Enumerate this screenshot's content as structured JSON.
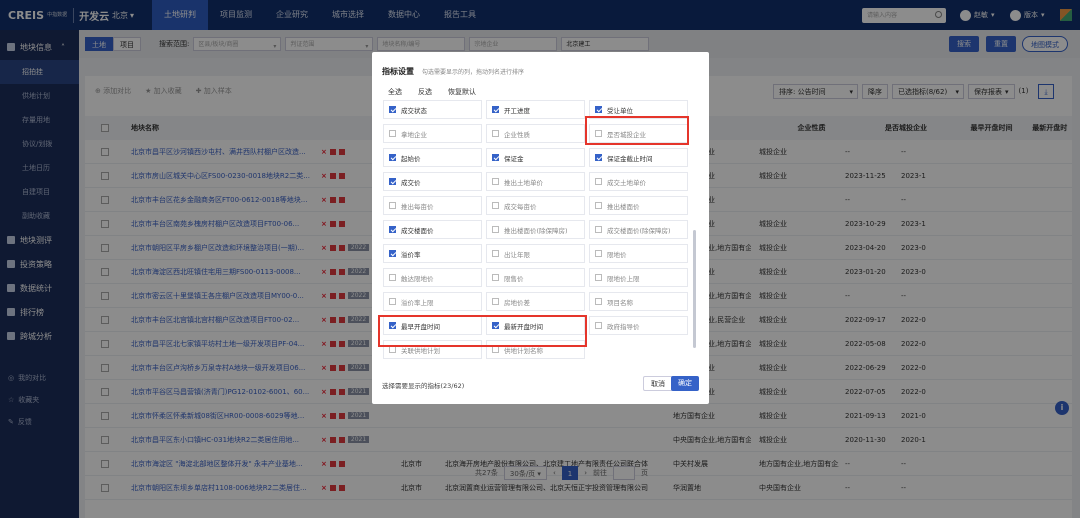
{
  "topnav": {
    "logo": "CREIS",
    "logo_sub": "中指数据",
    "app": "开发云",
    "city": "北京",
    "items": [
      "土地研判",
      "项目监测",
      "企业研究",
      "城市选择",
      "数据中心",
      "报告工具"
    ],
    "active": 0,
    "search_placeholder": "请输入内容",
    "user": "赵敏",
    "version": "版本"
  },
  "sidebar": {
    "main": "地块信息",
    "subs": [
      "招拍挂",
      "供地计划",
      "存量用地",
      "协议/划拨",
      "土地日历",
      "自建项目",
      "副助收藏"
    ],
    "active_sub": 0,
    "sections": [
      "地块测评",
      "投资策略",
      "数据统计",
      "排行榜",
      "跨城分析"
    ],
    "footer": [
      "我的对比",
      "收藏夹",
      "反馈"
    ]
  },
  "filterbar": {
    "toggle": [
      "土地",
      "项目"
    ],
    "label": "搜索范围:",
    "inputs": [
      "区县/板块/商圈",
      "判证范围",
      "地块名称/编号",
      "宗地企业"
    ],
    "input4": "北京建工",
    "search": "搜索",
    "reset": "重置",
    "map_mode": "地图模式"
  },
  "toolbar": {
    "items": [
      "添加对比",
      "加入收藏",
      "加入样本"
    ],
    "sort": "排序: 公告时间",
    "order": "降序",
    "selected": "已选指标(8/62)",
    "save": "保存报表",
    "count": "(1)"
  },
  "table": {
    "headers": [
      "地块名称",
      "企业性质",
      "是否城投企业",
      "最早开盘时间",
      "最新开盘时"
    ],
    "rows": [
      {
        "name": "北京市昌平区沙河镇西沙屯村、满井西队村棚户区改造...",
        "year": "",
        "d1": "",
        "d2": "",
        "c4": "地方国有企业",
        "c5": "城投企业",
        "c6": "--",
        "c7": "--"
      },
      {
        "name": "北京市房山区城关中心区FS00-0230-0018地块R2二类...",
        "year": "",
        "d1": "",
        "d2": "",
        "c4": "地方国有企业",
        "c5": "城投企业",
        "c6": "2023-11-25",
        "c7": "2023-1"
      },
      {
        "name": "北京市丰台区花乡金融商务区FT00-0612-0018等地块...",
        "year": "",
        "d1": "",
        "d2": "",
        "c4": "地方国有企业",
        "c5": "",
        "c6": "--",
        "c7": "--"
      },
      {
        "name": "北京市丰台区南苑乡槐房村棚户区改造项目FT00-06...",
        "year": "",
        "d1": "",
        "d2": "",
        "c4": "地方国有企业",
        "c5": "城投企业",
        "c6": "2023-10-29",
        "c7": "2023-1"
      },
      {
        "name": "北京市朝阳区平房乡棚户区改造和环境整治项目(一期)...",
        "year": "2022",
        "d1": "",
        "d2": "",
        "c4": "中央国有企业,地方国有企业",
        "c5": "城投企业",
        "c6": "2023-04-20",
        "c7": "2023-0"
      },
      {
        "name": "北京市海淀区西北旺镇住宅用三期FS00-0113-0008...",
        "year": "2022",
        "d1": "",
        "d2": "",
        "c4": "地方国有企业",
        "c5": "城投企业",
        "c6": "2023-01-20",
        "c7": "2023-0"
      },
      {
        "name": "北京市密云区十里堡镇王各庄棚户区改造项目MY00-0...",
        "year": "2022",
        "d1": "",
        "d2": "",
        "c4": "地方国有企业,地方国有企业",
        "c5": "城投企业",
        "c6": "--",
        "c7": "--"
      },
      {
        "name": "北京市丰台区北宫镇北宫村棚户区改造项目FT00-02...",
        "year": "2022",
        "d1": "",
        "d2": "",
        "c4": "地方国有企业,民营企业",
        "c5": "城投企业",
        "c6": "2022-09-17",
        "c7": "2022-0"
      },
      {
        "name": "北京市昌平区北七家镇平坊村土地一级开发项目PF-04...",
        "year": "2021",
        "d1": "",
        "d2": "",
        "c4": "地方国有企业,地方国有企业",
        "c5": "城投企业",
        "c6": "2022-05-08",
        "c7": "2022-0"
      },
      {
        "name": "北京市丰台区卢沟桥乡万泉寺村A地块一级开发项目06...",
        "year": "2021",
        "d1": "",
        "d2": "",
        "c4": "地方国有企业",
        "c5": "城投企业",
        "c6": "2022-06-29",
        "c7": "2022-0"
      },
      {
        "name": "北京市平谷区马昌营镇(济青门)PG12-0102-6001、60...",
        "year": "2021",
        "d1": "",
        "d2": "",
        "c4": "地方国有企业",
        "c5": "城投企业",
        "c6": "2022-07-05",
        "c7": "2022-0"
      },
      {
        "name": "北京市怀柔区怀柔新城08街区HR00-0008-6029等地...",
        "year": "2021",
        "d1": "",
        "d2": "",
        "c4": "地方国有企业",
        "c5": "城投企业",
        "c6": "2021-09-13",
        "c7": "2021-0"
      },
      {
        "name": "北京市昌平区东小口镇HC-031地块R2二类居住用地...",
        "year": "2021",
        "d1": "",
        "d2": "",
        "c4": "中央国有企业,地方国有企业",
        "c5": "城投企业",
        "c6": "2020-11-30",
        "c7": "2020-1"
      },
      {
        "name": "北京市海淀区 \"海淀北部地区整体开发\" 永丰产业基地...",
        "year": "",
        "d1": "北京市",
        "d2": "北京海开房地产股份有限公司、北京建工地产有限责任公司联合体",
        "c4": "中关村发展",
        "c5": "地方国有企业,地方国有企业",
        "c6": "--",
        "c7": "--"
      },
      {
        "name": "北京市朝阳区东坝乡单店村1108-006地块R2二类居住...",
        "year": "",
        "d1": "北京市",
        "d2": "北京润置商业运营管理有限公司、北京天恒正宇投资管理有限公司",
        "c4": "华润置地",
        "c5": "中央国有企业",
        "c6": "--",
        "c7": "--"
      }
    ]
  },
  "pager": {
    "total": "共27条",
    "per": "30条/页",
    "page": "1",
    "goto": "前往",
    "unit": "页"
  },
  "modal": {
    "title": "指标设置",
    "tip": "勾选需要显示的列，拖动列名进行排序",
    "tabs": [
      "全选",
      "反选",
      "恢复默认"
    ],
    "cells": [
      {
        "label": "成交状态",
        "on": true
      },
      {
        "label": "开工进度",
        "on": true
      },
      {
        "label": "受让单位",
        "on": true
      },
      {
        "label": "拿地企业",
        "on": false
      },
      {
        "label": "企业性质",
        "on": false
      },
      {
        "label": "是否城投企业",
        "on": false
      },
      {
        "label": "起始价",
        "on": true
      },
      {
        "label": "保证金",
        "on": true
      },
      {
        "label": "保证金截止时间",
        "on": true
      },
      {
        "label": "成交价",
        "on": true
      },
      {
        "label": "推出土地单价",
        "on": false
      },
      {
        "label": "成交土地单价",
        "on": false
      },
      {
        "label": "推出每亩价",
        "on": false
      },
      {
        "label": "成交每亩价",
        "on": false
      },
      {
        "label": "推出楼面价",
        "on": false
      },
      {
        "label": "成交楼面价",
        "on": true
      },
      {
        "label": "推出楼面价(除保障房)",
        "on": false
      },
      {
        "label": "成交楼面价(除保障房)",
        "on": false
      },
      {
        "label": "溢价率",
        "on": true
      },
      {
        "label": "出让年限",
        "on": false
      },
      {
        "label": "限地价",
        "on": false
      },
      {
        "label": "触达限地价",
        "on": false
      },
      {
        "label": "限售价",
        "on": false
      },
      {
        "label": "限地价上限",
        "on": false
      },
      {
        "label": "溢价率上限",
        "on": false
      },
      {
        "label": "房地价差",
        "on": false
      },
      {
        "label": "项目名称",
        "on": false
      },
      {
        "label": "最早开盘时间",
        "on": true
      },
      {
        "label": "最新开盘时间",
        "on": true
      },
      {
        "label": "政府指导价",
        "on": false
      },
      {
        "label": "关联供地计划",
        "on": false
      },
      {
        "label": "供地计划名称",
        "on": false
      }
    ],
    "footer": "选择需要显示的指标(23/62)",
    "cancel": "取消",
    "confirm": "确定"
  }
}
